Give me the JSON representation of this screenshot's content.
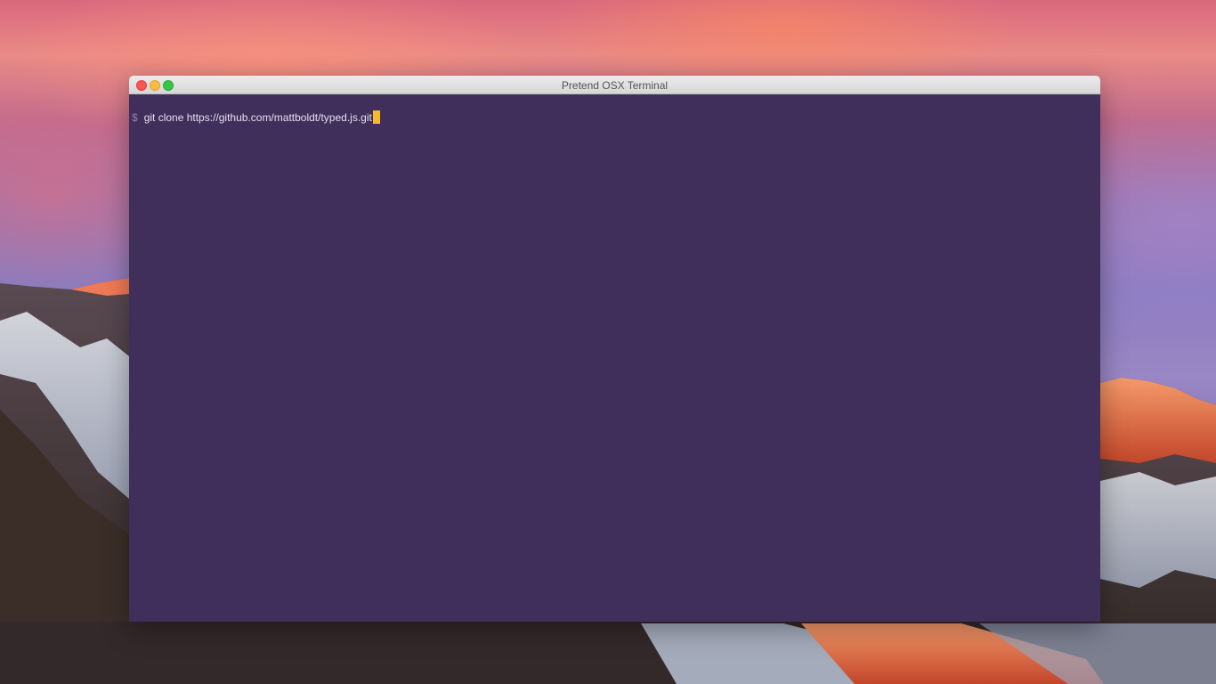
{
  "window": {
    "title": "Pretend OSX Terminal",
    "buttons": {
      "close_color": "#fc5753",
      "minimize_color": "#fdbc40",
      "maximize_color": "#33c748"
    }
  },
  "terminal": {
    "background": "#402e5b",
    "prompt": "$",
    "command": "git clone https://github.com/mattboldt/typed.js.git",
    "cursor_color": "#f7b92b"
  },
  "icons": {
    "close": "close-icon",
    "minimize": "minimize-icon",
    "maximize": "maximize-icon"
  }
}
